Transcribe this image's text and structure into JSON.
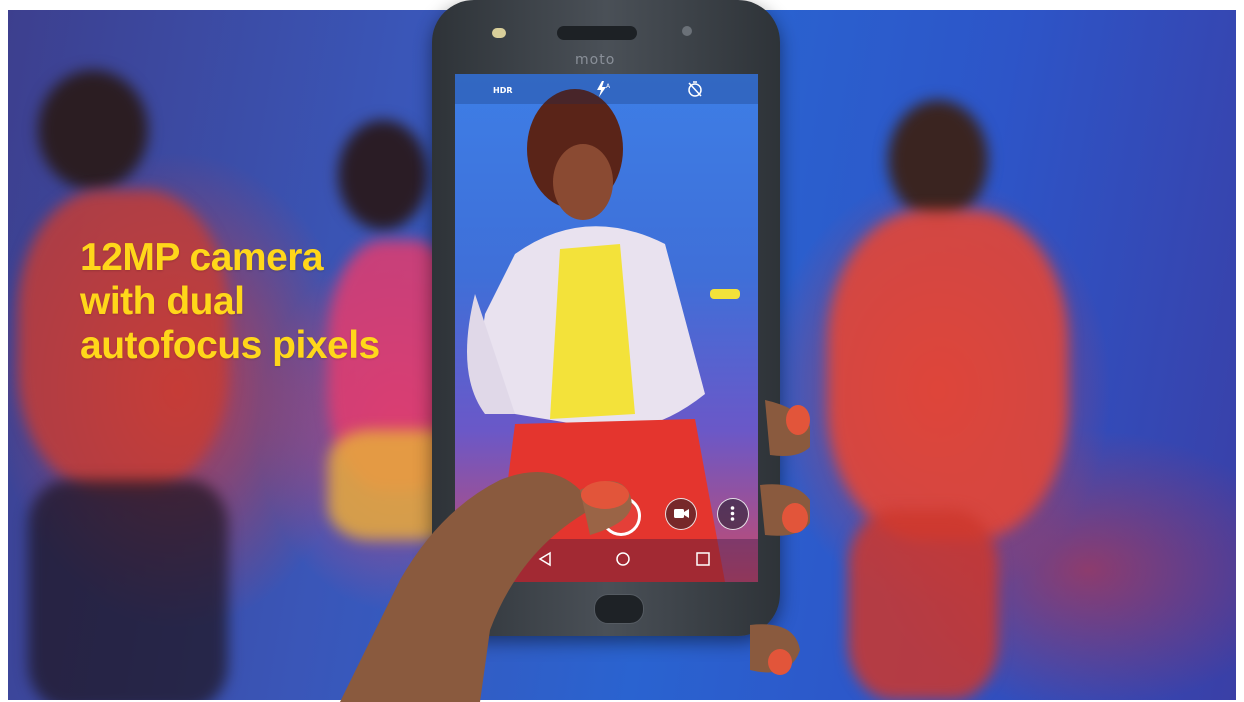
{
  "headline": {
    "line1": "12MP camera",
    "line2": "with dual",
    "line3": "autofocus pixels",
    "color": "#ffd71a"
  },
  "phone": {
    "brand": "moto",
    "camera_ui": {
      "hdr_label": "HDR",
      "icons": [
        "hdr-icon",
        "flash-auto-icon",
        "timer-off-icon",
        "shutter-button",
        "video-mode-icon",
        "more-options-icon"
      ],
      "nav_icons": [
        "back-icon",
        "home-icon",
        "recents-icon"
      ]
    }
  }
}
